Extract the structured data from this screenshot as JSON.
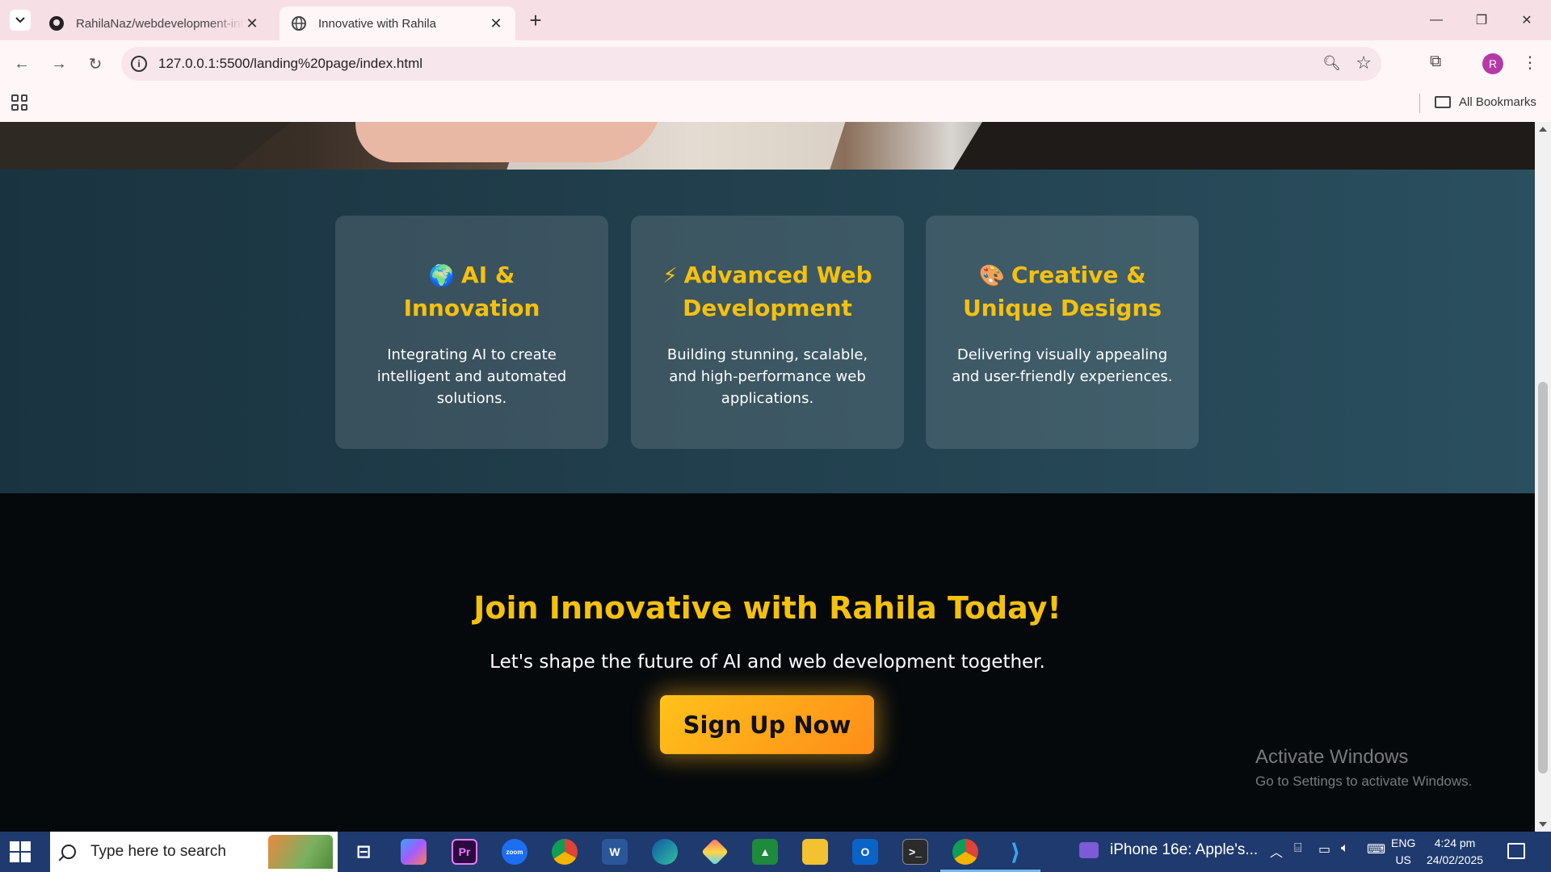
{
  "browser": {
    "tabs": [
      {
        "title": "RahilaNaz/webdevelopment-internship",
        "favicon": "github-icon"
      },
      {
        "title": "Innovative with Rahila",
        "favicon": "globe-icon"
      }
    ],
    "url": "127.0.0.1:5500/landing%20page/index.html",
    "avatar_letter": "R",
    "all_bookmarks": "All Bookmarks"
  },
  "features": [
    {
      "emoji": "🌍",
      "title": "AI & Innovation",
      "text": "Integrating AI to create intelligent and automated solutions."
    },
    {
      "emoji": "⚡",
      "title": "Advanced Web Development",
      "text": "Building stunning, scalable, and high-performance web applications."
    },
    {
      "emoji": "🎨",
      "title": "Creative & Unique Designs",
      "text": "Delivering visually appealing and user-friendly experiences."
    }
  ],
  "cta": {
    "heading": "Join Innovative with Rahila Today!",
    "subtext": "Let's shape the future of AI and web development together.",
    "button": "Sign Up Now"
  },
  "watermark": {
    "line1": "Activate Windows",
    "line2": "Go to Settings to activate Windows."
  },
  "taskbar": {
    "search_placeholder": "Type here to search",
    "media_title": "iPhone 16e: Apple's...",
    "lang_line1": "ENG",
    "lang_line2": "US",
    "time": "4:24 pm",
    "date": "24/02/2025"
  },
  "colors": {
    "accent_yellow": "#f5c10d",
    "features_bg": "#22404e",
    "button_gradient_start": "#ffc21a",
    "button_gradient_end": "#ff8c1a"
  }
}
